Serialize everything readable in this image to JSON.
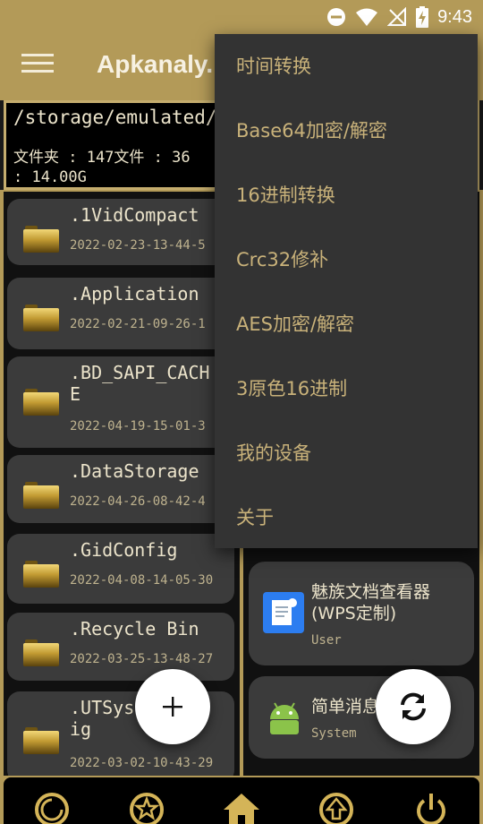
{
  "status_bar": {
    "time": "9:43"
  },
  "app_bar": {
    "title": "Apkanaly."
  },
  "path_box": {
    "path": "/storage/emulated/",
    "stats": "文件夹 : 147文件 : 36\n: 14.00G"
  },
  "files": [
    {
      "name": ".1VidCompact",
      "date": "2022-02-23-13-44-5"
    },
    {
      "name": ".Application",
      "date": "2022-02-21-09-26-1"
    },
    {
      "name": ".BD_SAPI_CACH\nE",
      "date": "2022-04-19-15-01-3"
    },
    {
      "name": ".DataStorage",
      "date": "2022-04-26-08-42-4"
    },
    {
      "name": ".GidConfig",
      "date": "2022-04-08-14-05-30"
    },
    {
      "name": ".Recycle Bin",
      "date": "2022-03-25-13-48-27"
    },
    {
      "name": ".UTSys    f\nig",
      "date": "2022-03-02-10-43-29"
    }
  ],
  "apps": [
    {
      "name": "魅族文档查看器\n(WPS定制)",
      "type": "User",
      "icon": "wps-document-icon"
    },
    {
      "name": "简单消息",
      "type": "System",
      "icon": "android-icon"
    }
  ],
  "menu": {
    "items": [
      "时间转换",
      "Base64加密/解密",
      "16进制转换",
      "Crc32修补",
      "AES加密/解密",
      "3原色16进制",
      "我的设备",
      "关于"
    ]
  },
  "bottom_nav": [
    "refresh-circle-icon",
    "star-icon",
    "home-icon",
    "up-arrow-icon",
    "power-icon"
  ],
  "colors": {
    "accent": "#b39a58",
    "menu_text": "#c9b27a",
    "card_bg": "#3b3b3b",
    "menu_bg": "#333333"
  }
}
